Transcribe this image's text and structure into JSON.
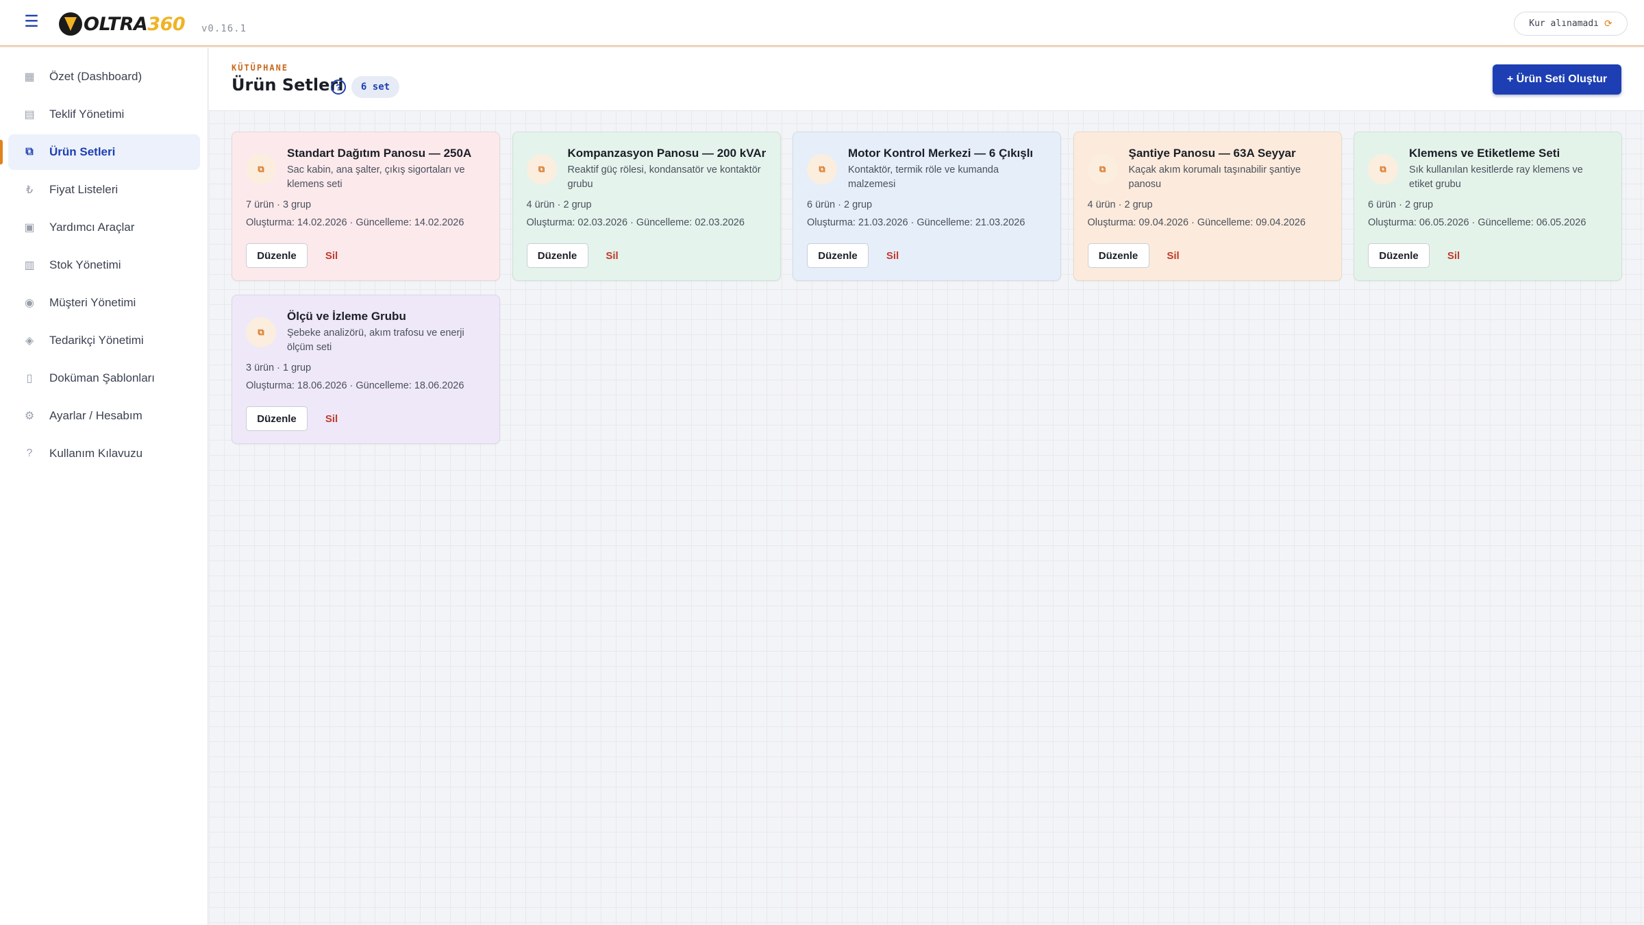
{
  "topbar": {
    "menu_icon": "hamburger-icon",
    "logo_main": "OLTRA",
    "logo_accent": "360",
    "version": "v0.16.1",
    "rate_status": "Kur alınamadı",
    "rate_icon": "⟳"
  },
  "sidebar": {
    "items": [
      {
        "label": "Özet (Dashboard)",
        "icon": "▦"
      },
      {
        "label": "Teklif Yönetimi",
        "icon": "▤"
      },
      {
        "label": "Ürün Setleri",
        "icon": "⧉"
      },
      {
        "label": "Fiyat Listeleri",
        "icon": "₺"
      },
      {
        "label": "Yardımcı Araçlar",
        "icon": "▣"
      },
      {
        "label": "Stok Yönetimi",
        "icon": "▥"
      },
      {
        "label": "Müşteri Yönetimi",
        "icon": "◉"
      },
      {
        "label": "Tedarikçi Yönetimi",
        "icon": "◈"
      },
      {
        "label": "Doküman Şablonları",
        "icon": "▯"
      },
      {
        "label": "Ayarlar / Hesabım",
        "icon": "⚙"
      },
      {
        "label": "Kullanım Kılavuzu",
        "icon": "?"
      }
    ],
    "active_index": 2
  },
  "header": {
    "eyebrow": "KÜTÜPHANE",
    "title": "Ürün Setleri",
    "help": "?",
    "count": "6 set",
    "create_label": "+ Ürün Seti Oluştur"
  },
  "card_labels": {
    "edit": "Düzenle",
    "delete": "Sil",
    "icon": "⧉"
  },
  "cards": [
    {
      "title": "Standart Dağıtım Panosu — 250A",
      "desc": "Sac kabin, ana şalter, çıkış sigortaları ve klemens seti",
      "meta": "7 ürün · 3 grup",
      "dates": "Oluşturma: 14.02.2026 · Güncelleme: 14.02.2026",
      "bg": "#fce9ec"
    },
    {
      "title": "Kompanzasyon Panosu — 200 kVAr",
      "desc": "Reaktif güç rölesi, kondansatör ve kontaktör grubu",
      "meta": "4 ürün · 2 grup",
      "dates": "Oluşturma: 02.03.2026 · Güncelleme: 02.03.2026",
      "bg": "#e4f3ec"
    },
    {
      "title": "Motor Kontrol Merkezi — 6 Çıkışlı",
      "desc": "Kontaktör, termik röle ve kumanda malzemesi",
      "meta": "6 ürün · 2 grup",
      "dates": "Oluşturma: 21.03.2026 · Güncelleme: 21.03.2026",
      "bg": "#e6eefa"
    },
    {
      "title": "Şantiye Panosu — 63A Seyyar",
      "desc": "Kaçak akım korumalı taşınabilir şantiye panosu",
      "meta": "4 ürün · 2 grup",
      "dates": "Oluşturma: 09.04.2026 · Güncelleme: 09.04.2026",
      "bg": "#fcebdc"
    },
    {
      "title": "Klemens ve Etiketleme Seti",
      "desc": "Sık kullanılan kesitlerde ray klemens ve etiket grubu",
      "meta": "6 ürün · 2 grup",
      "dates": "Oluşturma: 06.05.2026 · Güncelleme: 06.05.2026",
      "bg": "#e4f3ea"
    },
    {
      "title": "Ölçü ve İzleme Grubu",
      "desc": "Şebeke analizörü, akım trafosu ve enerji ölçüm seti",
      "meta": "3 ürün · 1 grup",
      "dates": "Oluşturma: 18.06.2026 · Güncelleme: 18.06.2026",
      "bg": "#efe8f8"
    }
  ]
}
